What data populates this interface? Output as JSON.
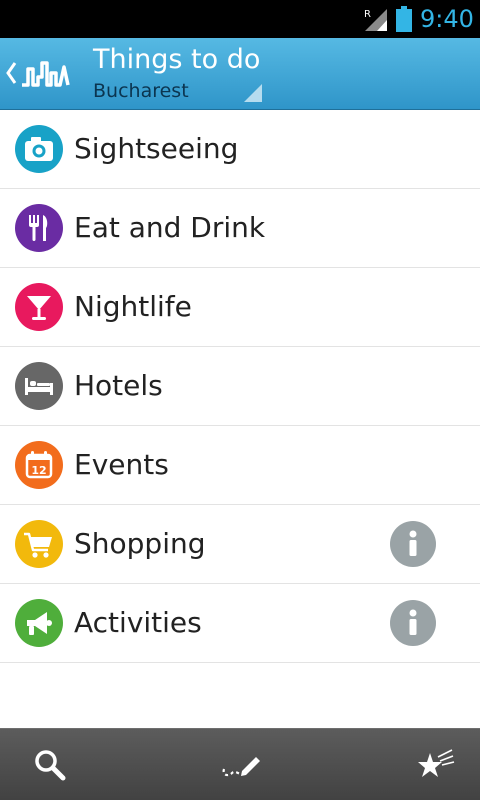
{
  "status_bar": {
    "time": "9:40",
    "signal_icon": "signal-roaming-icon",
    "battery_icon": "battery-icon",
    "accent": "#33b5e5"
  },
  "action_bar": {
    "title": "Things to do",
    "subtitle": "Bucharest",
    "logo_icon": "city-skyline-logo-icon",
    "background": "#3fa3d3"
  },
  "categories": [
    {
      "label": "Sightseeing",
      "icon": "camera-icon",
      "color": "#18a2c7",
      "info": false
    },
    {
      "label": "Eat and Drink",
      "icon": "fork-knife-icon",
      "color": "#6a2ca3",
      "info": false
    },
    {
      "label": "Nightlife",
      "icon": "cocktail-icon",
      "color": "#e8195e",
      "info": false
    },
    {
      "label": "Hotels",
      "icon": "bed-icon",
      "color": "#676767",
      "info": false
    },
    {
      "label": "Events",
      "icon": "calendar-icon",
      "color": "#f26c1c",
      "info": false,
      "icon_text": "12"
    },
    {
      "label": "Shopping",
      "icon": "shopping-cart-icon",
      "color": "#f2b90c",
      "info": true
    },
    {
      "label": "Activities",
      "icon": "megaphone-icon",
      "color": "#4fae3b",
      "info": true
    }
  ],
  "bottom_bar": {
    "buttons": [
      {
        "icon": "search-icon"
      },
      {
        "icon": "route-pencil-icon"
      },
      {
        "icon": "stars-icon"
      }
    ]
  }
}
